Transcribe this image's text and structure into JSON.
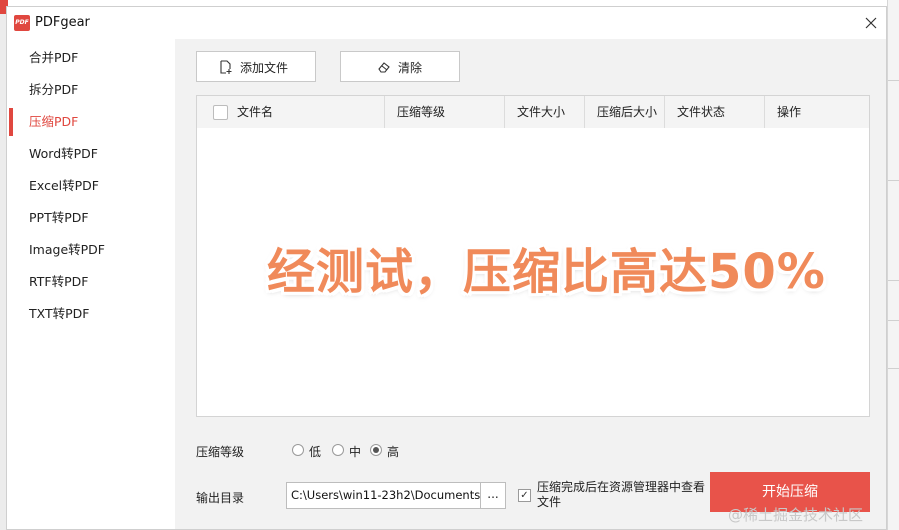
{
  "window": {
    "title": "PDFgear",
    "logo_text": "PDF"
  },
  "sidebar": {
    "items": [
      {
        "label": "合并PDF",
        "active": false
      },
      {
        "label": "拆分PDF",
        "active": false
      },
      {
        "label": "压缩PDF",
        "active": true
      },
      {
        "label": "Word转PDF",
        "active": false
      },
      {
        "label": "Excel转PDF",
        "active": false
      },
      {
        "label": "PPT转PDF",
        "active": false
      },
      {
        "label": "Image转PDF",
        "active": false
      },
      {
        "label": "RTF转PDF",
        "active": false
      },
      {
        "label": "TXT转PDF",
        "active": false
      }
    ]
  },
  "toolbar": {
    "add_file_label": "添加文件",
    "clear_label": "清除"
  },
  "table": {
    "columns": [
      "文件名",
      "压缩等级",
      "文件大小",
      "压缩后大小",
      "文件状态",
      "操作"
    ],
    "rows": []
  },
  "overlay": {
    "text": "经测试，压缩比高达50%"
  },
  "compression": {
    "label": "压缩等级",
    "options": [
      "低",
      "中",
      "高"
    ],
    "selected": "高"
  },
  "output": {
    "label": "输出目录",
    "path": "C:\\Users\\win11-23h2\\Documents",
    "browse_label": "...",
    "open_after_label": "压缩完成后在资源管理器中查看文件",
    "open_after_checked": true
  },
  "start_button_label": "开始压缩",
  "watermark": "@稀土掘金技术社区",
  "colors": {
    "accent": "#e0473f",
    "start_button": "#e8534a",
    "overlay_text": "#f08a5a"
  }
}
